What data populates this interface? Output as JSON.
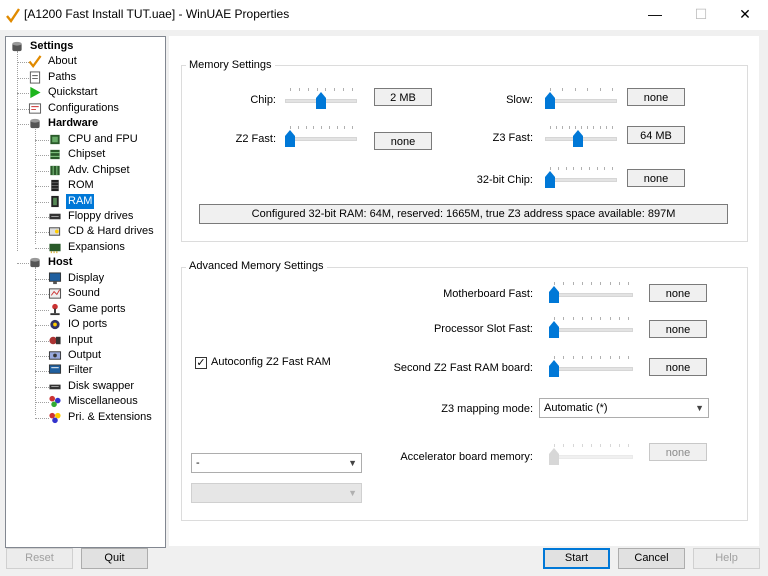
{
  "window": {
    "title": "[A1200 Fast Install TUT.uae] - WinUAE Properties",
    "minimize": "—",
    "maximize": "☐",
    "close": "✕"
  },
  "tree": [
    {
      "label": "Settings",
      "icon": "settings-root-icon",
      "level": 0,
      "bold": true
    },
    {
      "label": "About",
      "icon": "about-check-icon",
      "level": 1
    },
    {
      "label": "Paths",
      "icon": "paths-icon",
      "level": 1
    },
    {
      "label": "Quickstart",
      "icon": "quickstart-play-icon",
      "level": 1
    },
    {
      "label": "Configurations",
      "icon": "configurations-icon",
      "level": 1
    },
    {
      "label": "Hardware",
      "icon": "hardware-icon",
      "level": 1,
      "bold": true
    },
    {
      "label": "CPU and FPU",
      "icon": "cpu-chip-icon",
      "level": 2
    },
    {
      "label": "Chipset",
      "icon": "chipset-icon",
      "level": 2
    },
    {
      "label": "Adv. Chipset",
      "icon": "adv-chipset-icon",
      "level": 2
    },
    {
      "label": "ROM",
      "icon": "rom-icon",
      "level": 2
    },
    {
      "label": "RAM",
      "icon": "ram-icon",
      "level": 2,
      "selected": true
    },
    {
      "label": "Floppy drives",
      "icon": "floppy-drive-icon",
      "level": 2
    },
    {
      "label": "CD & Hard drives",
      "icon": "hard-drive-icon",
      "level": 2
    },
    {
      "label": "Expansions",
      "icon": "expansions-icon",
      "level": 2
    },
    {
      "label": "Host",
      "icon": "host-icon",
      "level": 1,
      "bold": true
    },
    {
      "label": "Display",
      "icon": "display-icon",
      "level": 2
    },
    {
      "label": "Sound",
      "icon": "sound-icon",
      "level": 2
    },
    {
      "label": "Game ports",
      "icon": "game-ports-icon",
      "level": 2
    },
    {
      "label": "IO ports",
      "icon": "io-ports-icon",
      "level": 2
    },
    {
      "label": "Input",
      "icon": "input-icon",
      "level": 2
    },
    {
      "label": "Output",
      "icon": "output-icon",
      "level": 2
    },
    {
      "label": "Filter",
      "icon": "filter-icon",
      "level": 2
    },
    {
      "label": "Disk swapper",
      "icon": "disk-swapper-icon",
      "level": 2
    },
    {
      "label": "Miscellaneous",
      "icon": "miscellaneous-icon",
      "level": 2
    },
    {
      "label": "Pri. & Extensions",
      "icon": "extensions-icon",
      "level": 2
    }
  ],
  "memory": {
    "title": "Memory Settings",
    "chip": {
      "label": "Chip:",
      "value": "2 MB",
      "position": 0.5
    },
    "z2fast": {
      "label": "Z2 Fast:",
      "value": "none",
      "position": 0.0
    },
    "slow": {
      "label": "Slow:",
      "value": "none",
      "position": 0.0
    },
    "z3fast": {
      "label": "Z3 Fast:",
      "value": "64 MB",
      "position": 0.45
    },
    "chip32": {
      "label": "32-bit Chip:",
      "value": "none",
      "position": 0.0
    },
    "info": "Configured 32-bit RAM: 64M, reserved: 1665M, true Z3 address space available: 897M"
  },
  "advanced": {
    "title": "Advanced Memory Settings",
    "motherboard_fast": {
      "label": "Motherboard Fast:",
      "value": "none",
      "position": 0.0
    },
    "processor_slot_fast": {
      "label": "Processor Slot Fast:",
      "value": "none",
      "position": 0.0
    },
    "second_z2": {
      "label": "Second Z2 Fast RAM board:",
      "value": "none",
      "position": 0.0
    },
    "autoconfig": {
      "label": "Autoconfig Z2 Fast RAM",
      "checked": true
    },
    "z3_mapping": {
      "label": "Z3 mapping mode:",
      "value": "Automatic (*)"
    },
    "accelerator": {
      "label": "Accelerator board memory:",
      "value": "none",
      "position": 0.0,
      "disabled": true
    },
    "board_select": {
      "value": "-"
    },
    "board_select2": {
      "value": ""
    }
  },
  "buttons": {
    "reset": "Reset",
    "quit": "Quit",
    "start": "Start",
    "cancel": "Cancel",
    "help": "Help"
  },
  "colors": {
    "accent": "#0078d7",
    "slider_thumb": "#0078d7"
  }
}
